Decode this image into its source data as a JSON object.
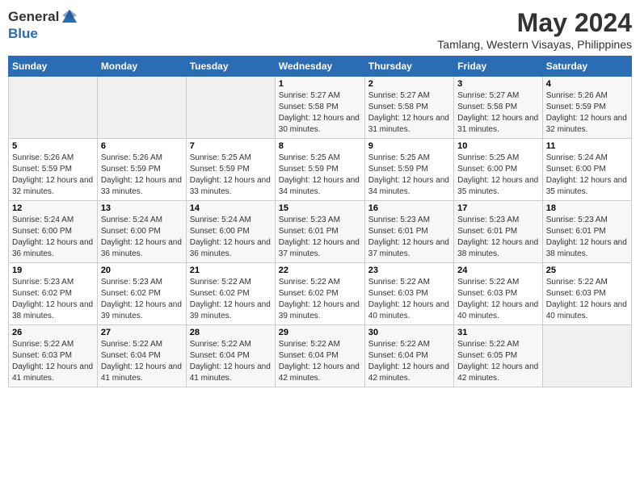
{
  "header": {
    "logo_general": "General",
    "logo_blue": "Blue",
    "month": "May 2024",
    "location": "Tamlang, Western Visayas, Philippines"
  },
  "days_of_week": [
    "Sunday",
    "Monday",
    "Tuesday",
    "Wednesday",
    "Thursday",
    "Friday",
    "Saturday"
  ],
  "weeks": [
    [
      {
        "day": "",
        "content": ""
      },
      {
        "day": "",
        "content": ""
      },
      {
        "day": "",
        "content": ""
      },
      {
        "day": "1",
        "content": "Sunrise: 5:27 AM\nSunset: 5:58 PM\nDaylight: 12 hours and 30 minutes."
      },
      {
        "day": "2",
        "content": "Sunrise: 5:27 AM\nSunset: 5:58 PM\nDaylight: 12 hours and 31 minutes."
      },
      {
        "day": "3",
        "content": "Sunrise: 5:27 AM\nSunset: 5:58 PM\nDaylight: 12 hours and 31 minutes."
      },
      {
        "day": "4",
        "content": "Sunrise: 5:26 AM\nSunset: 5:59 PM\nDaylight: 12 hours and 32 minutes."
      }
    ],
    [
      {
        "day": "5",
        "content": "Sunrise: 5:26 AM\nSunset: 5:59 PM\nDaylight: 12 hours and 32 minutes."
      },
      {
        "day": "6",
        "content": "Sunrise: 5:26 AM\nSunset: 5:59 PM\nDaylight: 12 hours and 33 minutes."
      },
      {
        "day": "7",
        "content": "Sunrise: 5:25 AM\nSunset: 5:59 PM\nDaylight: 12 hours and 33 minutes."
      },
      {
        "day": "8",
        "content": "Sunrise: 5:25 AM\nSunset: 5:59 PM\nDaylight: 12 hours and 34 minutes."
      },
      {
        "day": "9",
        "content": "Sunrise: 5:25 AM\nSunset: 5:59 PM\nDaylight: 12 hours and 34 minutes."
      },
      {
        "day": "10",
        "content": "Sunrise: 5:25 AM\nSunset: 6:00 PM\nDaylight: 12 hours and 35 minutes."
      },
      {
        "day": "11",
        "content": "Sunrise: 5:24 AM\nSunset: 6:00 PM\nDaylight: 12 hours and 35 minutes."
      }
    ],
    [
      {
        "day": "12",
        "content": "Sunrise: 5:24 AM\nSunset: 6:00 PM\nDaylight: 12 hours and 36 minutes."
      },
      {
        "day": "13",
        "content": "Sunrise: 5:24 AM\nSunset: 6:00 PM\nDaylight: 12 hours and 36 minutes."
      },
      {
        "day": "14",
        "content": "Sunrise: 5:24 AM\nSunset: 6:00 PM\nDaylight: 12 hours and 36 minutes."
      },
      {
        "day": "15",
        "content": "Sunrise: 5:23 AM\nSunset: 6:01 PM\nDaylight: 12 hours and 37 minutes."
      },
      {
        "day": "16",
        "content": "Sunrise: 5:23 AM\nSunset: 6:01 PM\nDaylight: 12 hours and 37 minutes."
      },
      {
        "day": "17",
        "content": "Sunrise: 5:23 AM\nSunset: 6:01 PM\nDaylight: 12 hours and 38 minutes."
      },
      {
        "day": "18",
        "content": "Sunrise: 5:23 AM\nSunset: 6:01 PM\nDaylight: 12 hours and 38 minutes."
      }
    ],
    [
      {
        "day": "19",
        "content": "Sunrise: 5:23 AM\nSunset: 6:02 PM\nDaylight: 12 hours and 38 minutes."
      },
      {
        "day": "20",
        "content": "Sunrise: 5:23 AM\nSunset: 6:02 PM\nDaylight: 12 hours and 39 minutes."
      },
      {
        "day": "21",
        "content": "Sunrise: 5:22 AM\nSunset: 6:02 PM\nDaylight: 12 hours and 39 minutes."
      },
      {
        "day": "22",
        "content": "Sunrise: 5:22 AM\nSunset: 6:02 PM\nDaylight: 12 hours and 39 minutes."
      },
      {
        "day": "23",
        "content": "Sunrise: 5:22 AM\nSunset: 6:03 PM\nDaylight: 12 hours and 40 minutes."
      },
      {
        "day": "24",
        "content": "Sunrise: 5:22 AM\nSunset: 6:03 PM\nDaylight: 12 hours and 40 minutes."
      },
      {
        "day": "25",
        "content": "Sunrise: 5:22 AM\nSunset: 6:03 PM\nDaylight: 12 hours and 40 minutes."
      }
    ],
    [
      {
        "day": "26",
        "content": "Sunrise: 5:22 AM\nSunset: 6:03 PM\nDaylight: 12 hours and 41 minutes."
      },
      {
        "day": "27",
        "content": "Sunrise: 5:22 AM\nSunset: 6:04 PM\nDaylight: 12 hours and 41 minutes."
      },
      {
        "day": "28",
        "content": "Sunrise: 5:22 AM\nSunset: 6:04 PM\nDaylight: 12 hours and 41 minutes."
      },
      {
        "day": "29",
        "content": "Sunrise: 5:22 AM\nSunset: 6:04 PM\nDaylight: 12 hours and 42 minutes."
      },
      {
        "day": "30",
        "content": "Sunrise: 5:22 AM\nSunset: 6:04 PM\nDaylight: 12 hours and 42 minutes."
      },
      {
        "day": "31",
        "content": "Sunrise: 5:22 AM\nSunset: 6:05 PM\nDaylight: 12 hours and 42 minutes."
      },
      {
        "day": "",
        "content": ""
      }
    ]
  ]
}
